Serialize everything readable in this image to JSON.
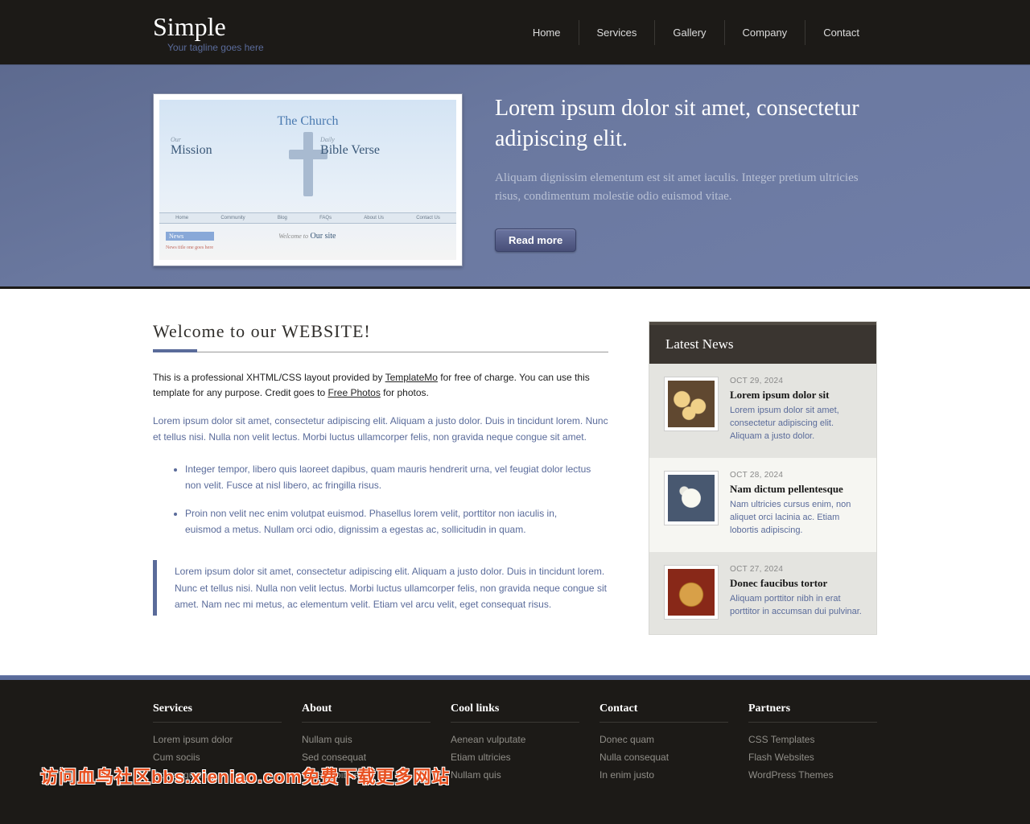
{
  "header": {
    "logo_title": "Simple",
    "logo_tagline": "Your tagline goes here",
    "nav": [
      "Home",
      "Services",
      "Gallery",
      "Company",
      "Contact"
    ]
  },
  "hero": {
    "heading": "Lorem ipsum dolor sit amet, consectetur adipiscing elit.",
    "sub": "Aliquam dignissim elementum est sit amet iaculis. Integer pretium ultricies risus, condimentum molestie odio euismod vitae.",
    "button": "Read more",
    "preview": {
      "title": "The Church",
      "left_small": "Our",
      "left_big": "Mission",
      "right_small": "Daily",
      "right_big": "Bible Verse",
      "menu": [
        "Home",
        "Community",
        "Blog",
        "FAQs",
        "About Us",
        "Contact Us"
      ],
      "news_label": "News",
      "news_item": "News title one goes here",
      "welcome_small": "Welcome to",
      "welcome_big": "Our site"
    }
  },
  "content": {
    "heading": "Welcome to our WEBSITE!",
    "intro_1": "This is a professional XHTML/CSS layout provided by ",
    "intro_link1": "TemplateMo",
    "intro_2": " for free of charge. You can use this template for any purpose. Credit goes to ",
    "intro_link2": "Free Photos",
    "intro_3": " for photos.",
    "para1": "Lorem ipsum dolor sit amet, consectetur adipiscing elit. Aliquam a justo dolor. Duis in tincidunt lorem. Nunc et tellus nisi. Nulla non velit lectus. Morbi luctus ullamcorper felis, non gravida neque congue sit amet.",
    "bullets": [
      "Integer tempor, libero quis laoreet dapibus, quam mauris hendrerit urna, vel feugiat dolor lectus non velit. Fusce at nisl libero, ac fringilla risus.",
      "Proin non velit nec enim volutpat euismod. Phasellus lorem velit, porttitor non iaculis in, euismod a metus. Nullam orci odio, dignissim a egestas ac, sollicitudin in quam."
    ],
    "quote": "Lorem ipsum dolor sit amet, consectetur adipiscing elit. Aliquam a justo dolor. Duis in tincidunt lorem. Nunc et tellus nisi. Nulla non velit lectus. Morbi luctus ullamcorper felis, non gravida neque congue sit amet. Nam nec mi metus, ac elementum velit. Etiam vel arcu velit, eget consequat risus."
  },
  "sidebar": {
    "heading": "Latest News",
    "items": [
      {
        "date": "OCT 29, 2024",
        "title": "Lorem ipsum dolor sit",
        "excerpt": "Lorem ipsum dolor sit amet, consectetur adipiscing elit. Aliquam a justo dolor."
      },
      {
        "date": "OCT 28, 2024",
        "title": "Nam dictum pellentesque",
        "excerpt": "Nam ultricies cursus enim, non aliquet orci lacinia ac. Etiam lobortis adipiscing."
      },
      {
        "date": "OCT 27, 2024",
        "title": "Donec faucibus tortor",
        "excerpt": "Aliquam porttitor nibh in erat porttitor in accumsan dui pulvinar."
      }
    ]
  },
  "footer": {
    "cols": [
      {
        "title": "Services",
        "links": [
          "Lorem ipsum dolor",
          "Cum sociis",
          "Donec quam"
        ]
      },
      {
        "title": "About",
        "links": [
          "Nullam quis",
          "Sed consequat",
          "Cras dapibus"
        ]
      },
      {
        "title": "Cool links",
        "links": [
          "Aenean vulputate",
          "Etiam ultricies",
          "Nullam quis"
        ]
      },
      {
        "title": "Contact",
        "links": [
          "Donec quam",
          "Nulla consequat",
          "In enim justo"
        ]
      },
      {
        "title": "Partners",
        "links": [
          "CSS Templates",
          "Flash Websites",
          "WordPress Themes"
        ]
      }
    ]
  },
  "watermark": "访问血鸟社区bbs.xieniao.com免费下载更多网站"
}
